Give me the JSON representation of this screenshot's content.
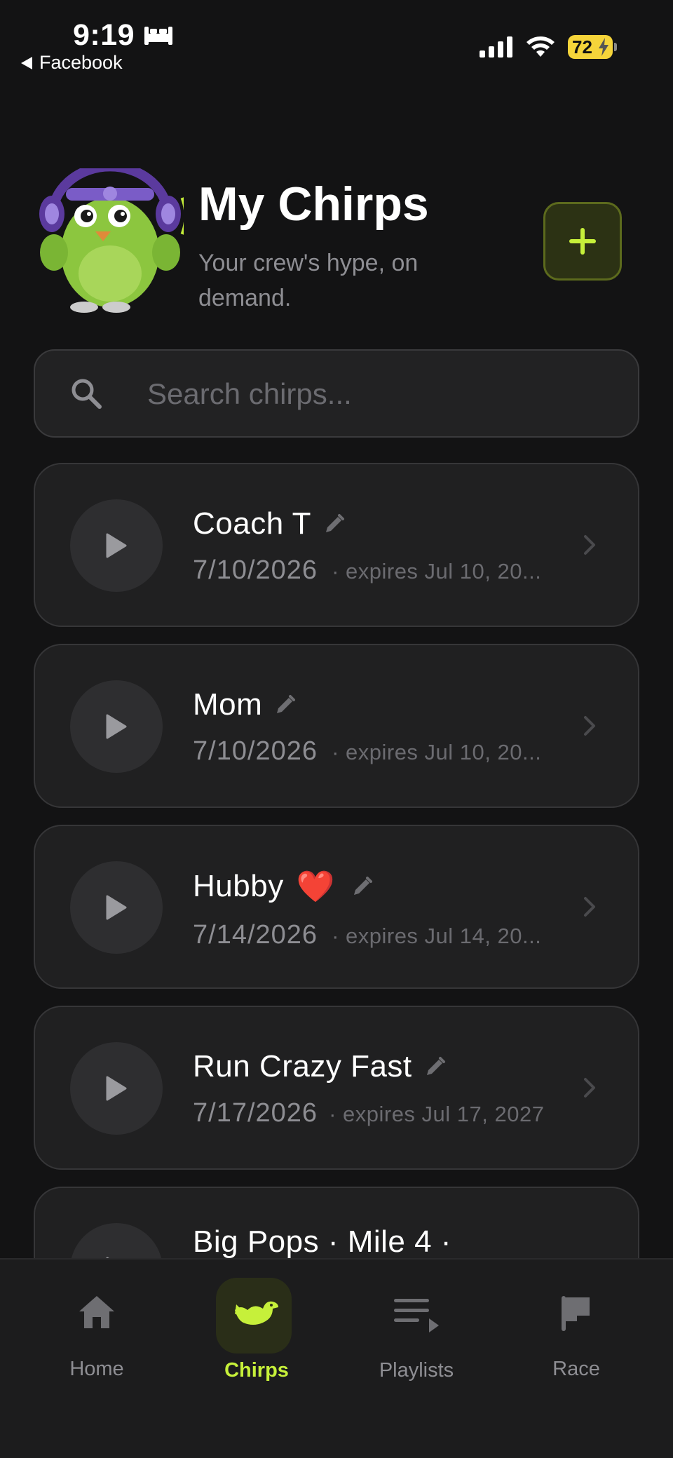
{
  "status_bar": {
    "time": "9:19",
    "back_app": "Facebook",
    "battery": "72"
  },
  "header": {
    "title": "My Chirps",
    "subtitle": "Your crew's hype, on demand."
  },
  "search": {
    "placeholder": "Search chirps..."
  },
  "chirps": [
    {
      "name": "Coach T",
      "emoji": "",
      "date": "7/10/2026",
      "expires": "· expires Jul 10, 20..."
    },
    {
      "name": "Mom",
      "emoji": "",
      "date": "7/10/2026",
      "expires": "· expires Jul 10, 20..."
    },
    {
      "name": "Hubby",
      "emoji": "❤️",
      "date": "7/14/2026",
      "expires": "· expires Jul 14, 20..."
    },
    {
      "name": "Run Crazy Fast",
      "emoji": "",
      "date": "7/17/2026",
      "expires": "· expires Jul 17, 2027"
    },
    {
      "name": "Big Pops · Mile 4 ·",
      "emoji": "",
      "date": "",
      "expires": ""
    }
  ],
  "tabs": [
    {
      "label": "Home",
      "icon": "home-icon",
      "active": false
    },
    {
      "label": "Chirps",
      "icon": "bird-icon",
      "active": true
    },
    {
      "label": "Playlists",
      "icon": "playlist-icon",
      "active": false
    },
    {
      "label": "Race",
      "icon": "flag-icon",
      "active": false
    }
  ],
  "colors": {
    "background": "#131314",
    "accent": "#c6f03a",
    "card": "#202021"
  }
}
